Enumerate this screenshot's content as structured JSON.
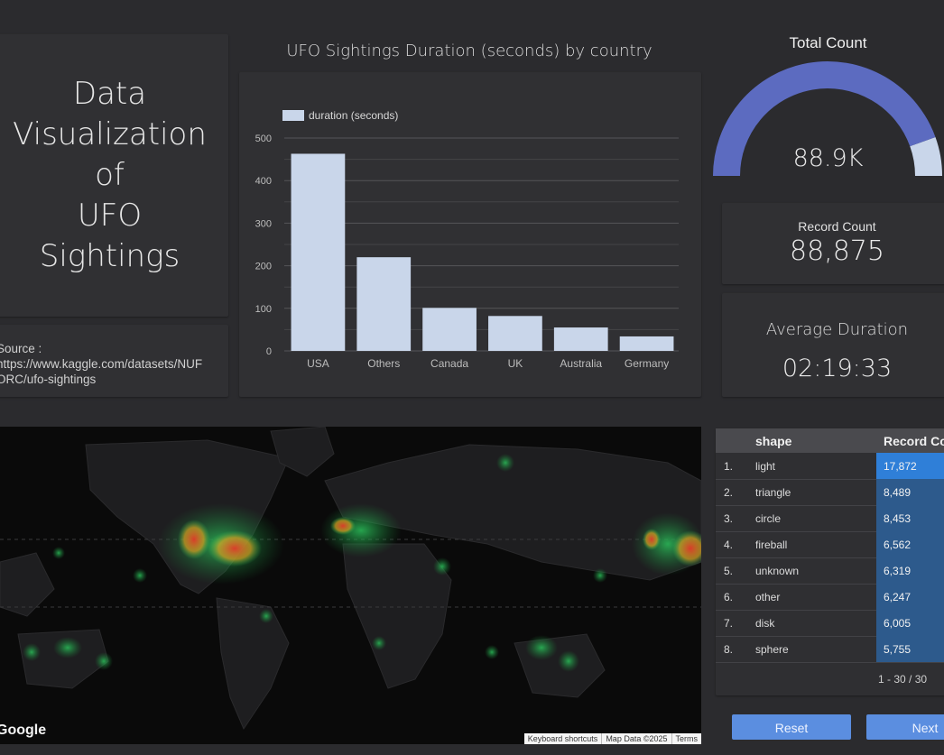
{
  "title": "Data\nVisualization\nof\nUFO\nSightings",
  "source": "Source :\nhttps://www.kaggle.com/datasets/NUF\nORC/ufo-sightings",
  "chart_data": {
    "type": "bar",
    "title": "UFO Sightings Duration (seconds) by country",
    "categories": [
      "USA",
      "Others",
      "Canada",
      "UK",
      "Australia",
      "Germany"
    ],
    "series": [
      {
        "name": "duration (seconds)",
        "values": [
          463,
          220,
          101,
          82,
          55,
          34
        ]
      }
    ],
    "ylim": [
      0,
      500
    ],
    "yticks": [
      0,
      100,
      200,
      300,
      400,
      500
    ],
    "xlabel": "",
    "ylabel": "",
    "legend": "top-left",
    "grid": true,
    "color": "#c9d6ea"
  },
  "gauge": {
    "title": "Total Count",
    "value_label": "88.9K",
    "fill_fraction": 0.89,
    "fill_color": "#5c6bc0",
    "rest_color": "#c9d6ea"
  },
  "record_count": {
    "label": "Record Count",
    "value": "88,875"
  },
  "average_duration": {
    "label": "Average Duration",
    "value": "02:19:33"
  },
  "map": {
    "logo": "Google",
    "attribution": [
      "Keyboard shortcuts",
      "Map Data ©2025",
      "Terms"
    ]
  },
  "table": {
    "headers": [
      "shape",
      "Record Co"
    ],
    "max": 17872,
    "rows": [
      {
        "idx": "1.",
        "shape": "light",
        "count": "17,872",
        "value": 17872
      },
      {
        "idx": "2.",
        "shape": "triangle",
        "count": "8,489",
        "value": 8489
      },
      {
        "idx": "3.",
        "shape": "circle",
        "count": "8,453",
        "value": 8453
      },
      {
        "idx": "4.",
        "shape": "fireball",
        "count": "6,562",
        "value": 6562
      },
      {
        "idx": "5.",
        "shape": "unknown",
        "count": "6,319",
        "value": 6319
      },
      {
        "idx": "6.",
        "shape": "other",
        "count": "6,247",
        "value": 6247
      },
      {
        "idx": "7.",
        "shape": "disk",
        "count": "6,005",
        "value": 6005
      },
      {
        "idx": "8.",
        "shape": "sphere",
        "count": "5,755",
        "value": 5755
      }
    ],
    "pager": "1 - 30 / 30"
  },
  "buttons": {
    "reset": "Reset",
    "next": "Next"
  }
}
